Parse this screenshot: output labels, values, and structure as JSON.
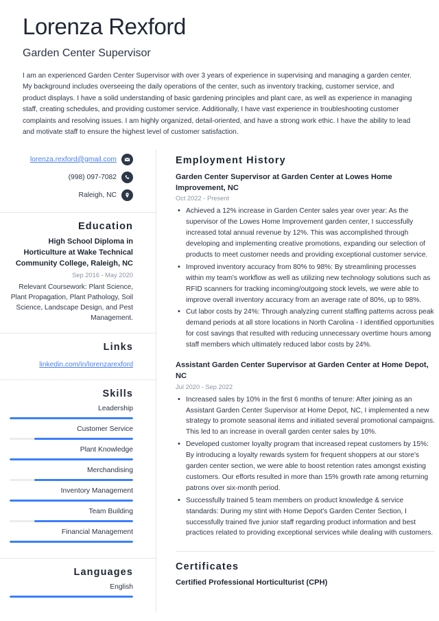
{
  "header": {
    "name": "Lorenza Rexford",
    "job_title": "Garden Center Supervisor",
    "summary": "I am an experienced Garden Center Supervisor with over 3 years of experience in supervising and managing a garden center. My background includes overseeing the daily operations of the center, such as inventory tracking, customer service, and product displays. I have a solid understanding of basic gardening principles and plant care, as well as experience in managing staff, creating schedules, and providing customer service. Additionally, I have vast experience in troubleshooting customer complaints and resolving issues. I am highly organized, detail-oriented, and have a strong work ethic. I have the ability to lead and motivate staff to ensure the highest level of customer satisfaction."
  },
  "contact": {
    "email": "lorenza.rexford@gmail.com",
    "phone": "(998) 097-7082",
    "location": "Raleigh, NC",
    "email_icon": "envelope-icon",
    "phone_icon": "phone-icon",
    "location_icon": "location-pin-icon"
  },
  "education": {
    "heading": "Education",
    "degree": "High School Diploma in Horticulture at Wake Technical Community College, Raleigh, NC",
    "date": "Sep 2016 - May 2020",
    "description": "Relevant Coursework: Plant Science, Plant Propagation, Plant Pathology, Soil Science, Landscape Design, and Pest Management."
  },
  "links": {
    "heading": "Links",
    "items": [
      {
        "label": "linkedin.com/in/lorenzarexford"
      }
    ]
  },
  "skills": {
    "heading": "Skills",
    "items": [
      {
        "label": "Leadership",
        "level": 100
      },
      {
        "label": "Customer Service",
        "level": 80
      },
      {
        "label": "Plant Knowledge",
        "level": 100
      },
      {
        "label": "Merchandising",
        "level": 80
      },
      {
        "label": "Inventory Management",
        "level": 100
      },
      {
        "label": "Team Building",
        "level": 80
      },
      {
        "label": "Financial Management",
        "level": 100
      }
    ]
  },
  "languages": {
    "heading": "Languages",
    "items": [
      {
        "label": "English",
        "level": 100
      }
    ]
  },
  "employment": {
    "heading": "Employment History",
    "jobs": [
      {
        "title": "Garden Center Supervisor at Garden Center at Lowes Home Improvement, NC",
        "date": "Oct 2022 - Present",
        "bullets": [
          "Achieved a 12% increase in Garden Center sales year over year: As the supervisor of the Lowes Home Improvement garden center, I successfully increased total annual revenue by 12%. This was accomplished through developing and implementing creative promotions, expanding our selection of products to meet customer needs and providing exceptional customer service.",
          "Improved inventory accuracy from 80% to 98%: By streamlining processes within my team's workflow as well as utilizing new technology solutions such as RFID scanners for tracking incoming/outgoing stock levels, we were able to improve overall inventory accuracy from an average rate of 80%, up to 98%.",
          "Cut labor costs by 24%: Through analyzing current staffing patterns across peak demand periods at all store locations in North Carolina - I identified opportunities for cost savings that resulted with reducing unnecessary overtime hours among staff members which ultimately reduced labor costs by 24%."
        ]
      },
      {
        "title": "Assistant Garden Center Supervisor at Garden Center at Home Depot, NC",
        "date": "Jul 2020 - Sep 2022",
        "bullets": [
          "Increased sales by 10% in the first 6 months of tenure: After joining as an Assistant Garden Center Supervisor at Home Depot, NC, I implemented a new strategy to promote seasonal items and initiated several promotional campaigns. This led to an increase in overall garden center sales by 10%.",
          "Developed customer loyalty program that increased repeat customers by 15%: By introducing a loyalty rewards system for frequent shoppers at our store's garden center section, we were able to boost retention rates amongst existing customers. Our efforts resulted in more than 15% growth rate among returning patrons over six-month period.",
          "Successfully trained 5 team members on product knowledge & service standards: During my stint with Home Depot's Garden Center Section, I successfully trained five junior staff regarding product information and best practices related to providing exceptional services while dealing with customers."
        ]
      }
    ]
  },
  "certificates": {
    "heading": "Certificates",
    "items": [
      {
        "name": "Certified Professional Horticulturist (CPH)"
      }
    ]
  },
  "colors": {
    "accent": "#3b7ffa",
    "link": "#4a7ff0",
    "icon_bg": "#2d3748",
    "heading": "#1f2733",
    "muted": "#8b94a3",
    "track": "#ececec"
  }
}
